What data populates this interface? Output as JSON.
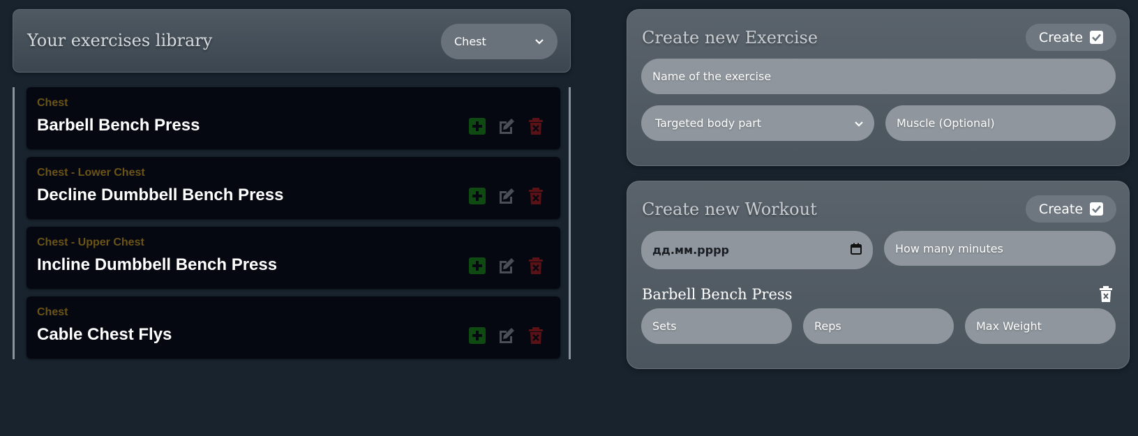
{
  "library": {
    "title": "Your exercises library",
    "filter_value": "Chest",
    "exercises": [
      {
        "category": "Chest",
        "name": "Barbell Bench Press"
      },
      {
        "category": "Chest - Lower Chest",
        "name": "Decline Dumbbell Bench Press"
      },
      {
        "category": "Chest - Upper Chest",
        "name": "Incline Dumbbell Bench Press"
      },
      {
        "category": "Chest",
        "name": "Cable Chest Flys"
      }
    ],
    "action_icons": [
      "plus-square-icon",
      "edit-icon",
      "trash-x-icon"
    ]
  },
  "create_exercise": {
    "title": "Create new Exercise",
    "create_label": "Create",
    "name_placeholder": "Name of the exercise",
    "body_part_placeholder": "Targeted body part",
    "muscle_placeholder": "Muscle (Optional)"
  },
  "create_workout": {
    "title": "Create new Workout",
    "create_label": "Create",
    "date_placeholder": "дд.мм.рррр",
    "minutes_placeholder": "How many minutes",
    "selected_exercise": "Barbell Bench Press",
    "sets_placeholder": "Sets",
    "reps_placeholder": "Reps",
    "weight_placeholder": "Max Weight"
  },
  "colors": {
    "background": "#18232d",
    "card": "#050811",
    "category_text": "#6b5418",
    "add_icon": "#0f4a12",
    "edit_icon": "#4a4f55",
    "delete_icon": "#5a1216"
  }
}
